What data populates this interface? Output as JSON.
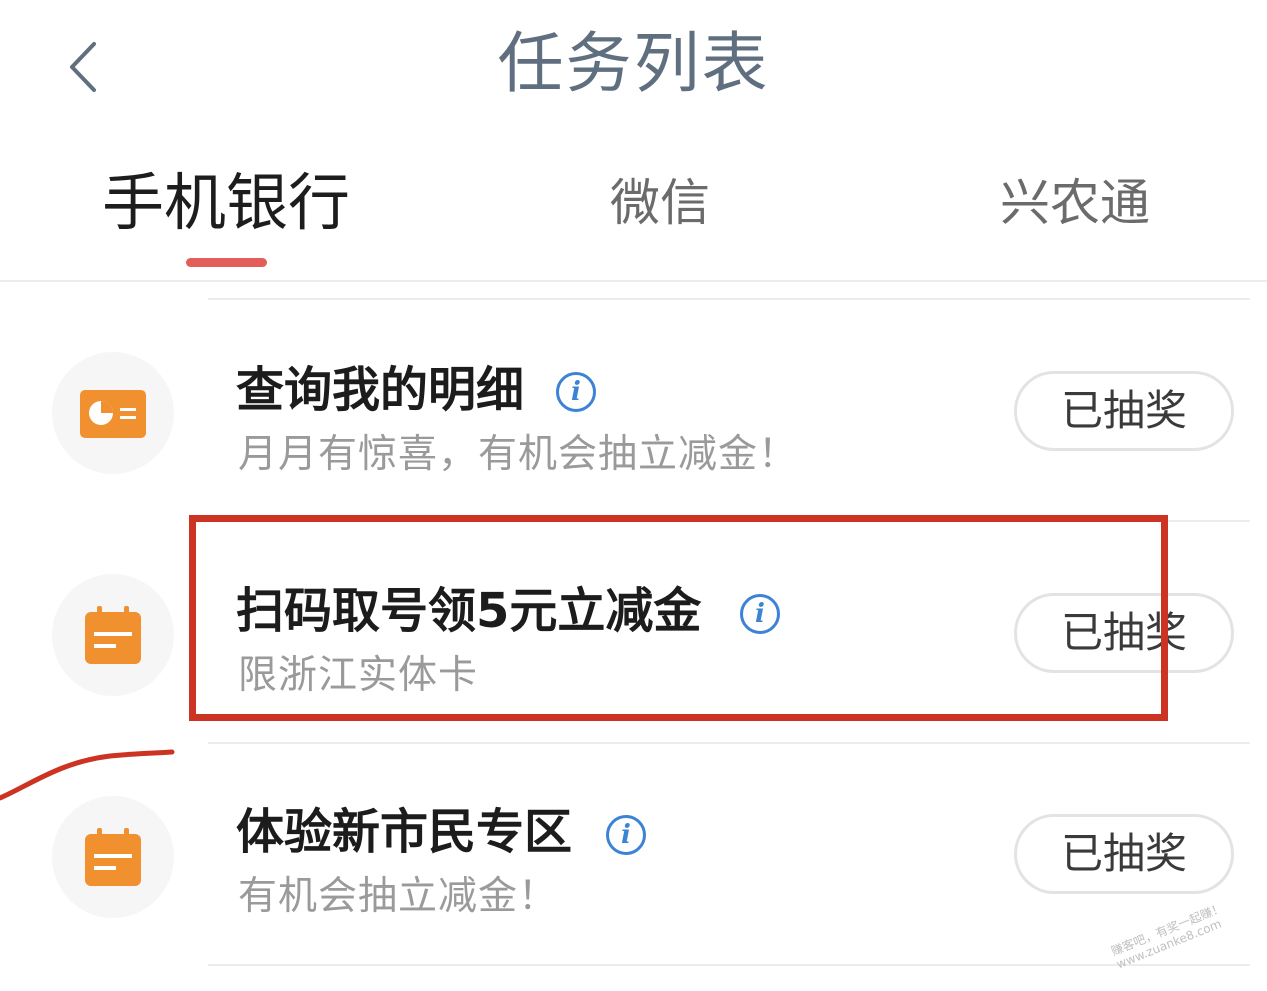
{
  "header": {
    "back_icon": "chevron-left-icon",
    "title": "任务列表"
  },
  "tabs": [
    {
      "label": "手机银行",
      "active": true
    },
    {
      "label": "微信",
      "active": false
    },
    {
      "label": "兴农通",
      "active": false
    }
  ],
  "colors": {
    "accent": "#e35d5b",
    "title": "#5f6f80",
    "icon_orange": "#f0902e",
    "info_blue": "#3c83d6",
    "annotation_red": "#cc3322"
  },
  "tasks": [
    {
      "icon": "card-chart-icon",
      "title": "查询我的明细",
      "subtitle": "月月有惊喜，有机会抽立减金！",
      "status": "已抽奖"
    },
    {
      "icon": "calendar-icon",
      "title": "扫码取号领5元立减金",
      "subtitle": "限浙江实体卡",
      "status": "已抽奖",
      "highlighted": true
    },
    {
      "icon": "calendar-icon",
      "title": "体验新市民专区",
      "subtitle": "有机会抽立减金！",
      "status": "已抽奖"
    }
  ],
  "watermark": {
    "line1": "赚客吧，有奖一起赚！",
    "line2": "www.zuanke8.com"
  }
}
